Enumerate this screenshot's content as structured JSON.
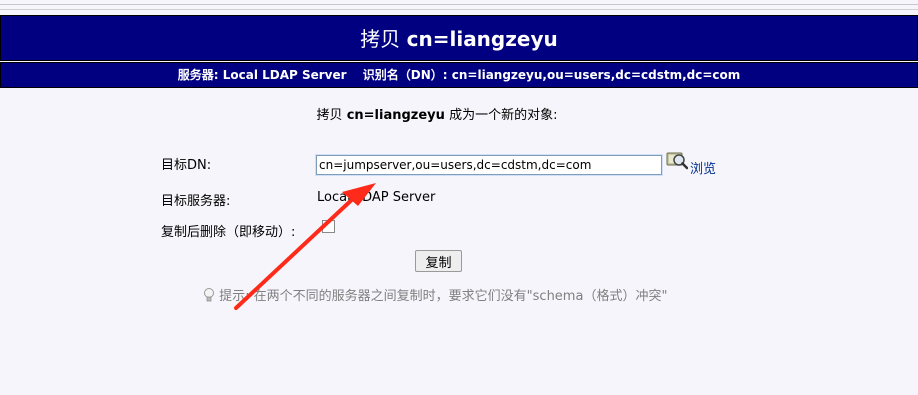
{
  "header": {
    "title_prefix": "拷贝",
    "title_object": "cn=liangzeyu"
  },
  "info": {
    "server_label": "服务器:",
    "server_value": "Local LDAP Server",
    "dn_label": "识别名（DN）:",
    "dn_value": "cn=liangzeyu,ou=users,dc=cdstm,dc=com"
  },
  "form": {
    "intro_prefix": "拷贝",
    "intro_object": "cn=liangzeyu",
    "intro_suffix": "成为一个新的对象:",
    "target_dn_label": "目标DN:",
    "target_dn_value": "cn=jumpserver,ou=users,dc=cdstm,dc=com",
    "browse_label": "浏览",
    "target_server_label": "目标服务器:",
    "target_server_value": "Local LDAP Server",
    "delete_after_copy_label": "复制后删除（即移动）:",
    "delete_after_copy_checked": false,
    "copy_button": "复制"
  },
  "hint": {
    "label": "提示:",
    "text": "在两个不同的服务器之间复制时，要求它们没有\"schema（格式）冲突\""
  },
  "colors": {
    "header_bg": "#000080",
    "annotation_arrow": "#ff2a1a"
  }
}
